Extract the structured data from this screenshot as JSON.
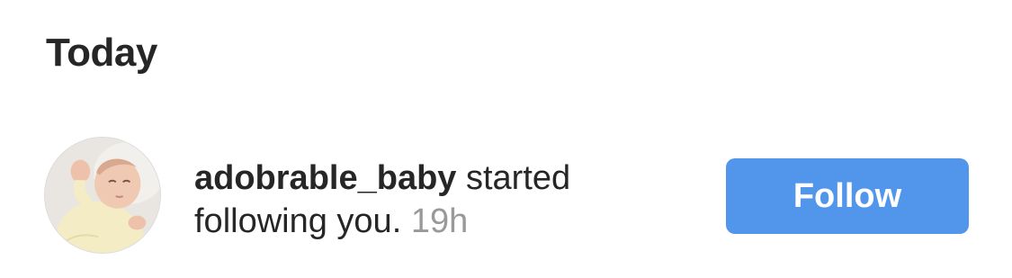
{
  "section": {
    "title": "Today"
  },
  "notification": {
    "username": "adobrable_baby",
    "action": "started following you.",
    "time": "19h",
    "follow_label": "Follow",
    "avatar_icon": "baby-profile-photo"
  },
  "colors": {
    "follow_button": "#5196ea",
    "timestamp": "#999999",
    "text": "#262626"
  }
}
